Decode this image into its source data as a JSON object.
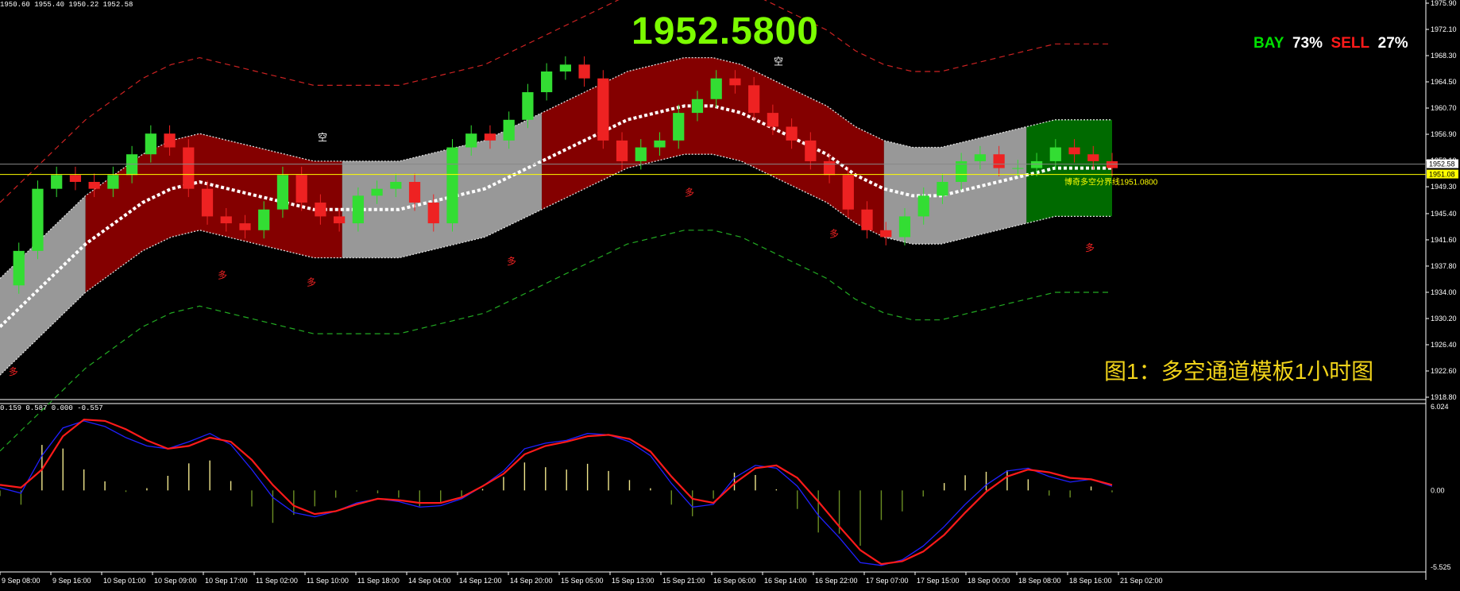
{
  "header": {
    "ohlc_text": "1950.60 1955.40 1950.22 1952.58",
    "current_price_big": "1952.5800",
    "sentiment": {
      "buy_label": "BAY",
      "buy_pct": "73%",
      "sell_label": "SELL",
      "sell_pct": "27%"
    },
    "caption": "图1：多空通道模板1小时图"
  },
  "colors": {
    "background": "#000000",
    "bull_candle": "#33dd33",
    "bear_candle": "#ee2222",
    "bull_channel": "#8b0000",
    "bear_channel": "#007000",
    "neutral_channel": "#a0a0a0",
    "upper_band": "#cc2222",
    "lower_band": "#22aa22",
    "price_line": "#ffff00",
    "macd_signal": "#ff1a1a",
    "macd_line": "#2020ff"
  },
  "chart_data": [
    {
      "type": "line",
      "title": "",
      "xlabel": "",
      "ylabel": "",
      "ylim": [
        1918.8,
        1975.9
      ],
      "y_ticks": [
        "1975.90",
        "1972.10",
        "1968.30",
        "1964.50",
        "1960.70",
        "1956.90",
        "1953.10",
        "1949.30",
        "1945.40",
        "1941.60",
        "1937.80",
        "1934.00",
        "1930.20",
        "1926.40",
        "1922.60",
        "1918.80"
      ],
      "x_ticks": [
        "9 Sep 08:00",
        "9 Sep 16:00",
        "10 Sep 01:00",
        "10 Sep 09:00",
        "10 Sep 17:00",
        "11 Sep 02:00",
        "11 Sep 10:00",
        "11 Sep 18:00",
        "14 Sep 04:00",
        "14 Sep 12:00",
        "14 Sep 20:00",
        "15 Sep 05:00",
        "15 Sep 13:00",
        "15 Sep 21:00",
        "16 Sep 06:00",
        "16 Sep 14:00",
        "16 Sep 22:00",
        "17 Sep 07:00",
        "17 Sep 15:00",
        "18 Sep 00:00",
        "18 Sep 08:00",
        "18 Sep 16:00",
        "21 Sep 02:00"
      ],
      "current_price_label": "1952.58",
      "boundary_price_label": "1951.08",
      "boundary_line_label": "博奇多空分界线1951.0800",
      "series": [
        {
          "values": [
            1935,
            1940,
            1949,
            1951,
            1950,
            1949,
            1951,
            1954,
            1957,
            1955,
            1949,
            1945,
            1944,
            1943,
            1946,
            1951,
            1947,
            1945,
            1944,
            1948,
            1949,
            1950,
            1947,
            1944,
            1955,
            1957,
            1956,
            1959,
            1963,
            1966,
            1967,
            1965,
            1956,
            1953,
            1955,
            1956,
            1960,
            1962,
            1965,
            1964,
            1960,
            1958,
            1956,
            1953,
            1951,
            1946,
            1943,
            1942,
            1945,
            1948,
            1950,
            1953,
            1954,
            1952,
            1952,
            1953,
            1955,
            1954,
            1953,
            1952
          ]
        },
        {
          "values": [
            1929,
            1933,
            1937,
            1941,
            1944,
            1947,
            1949,
            1950,
            1949,
            1948,
            1947,
            1946,
            1946,
            1946,
            1946,
            1947,
            1948,
            1949,
            1951,
            1953,
            1955,
            1957,
            1959,
            1960,
            1961,
            1961,
            1960,
            1958,
            1956,
            1954,
            1951,
            1949,
            1948,
            1948,
            1949,
            1950,
            1951,
            1952,
            1952,
            1952
          ]
        }
      ],
      "markers": {
        "buy_glyph": "多",
        "sell_glyph": "空"
      }
    },
    {
      "type": "line",
      "title": "",
      "header_values": "0.159 0.587 0.000 -0.557",
      "ylim": [
        -5.525,
        6.024
      ],
      "y_ticks": [
        "6.024",
        "0.00",
        "-5.525"
      ],
      "series": [
        {
          "values": [
            0.2,
            -0.2,
            2.5,
            4.5,
            5.0,
            4.6,
            3.8,
            3.2,
            3.0,
            3.5,
            4.1,
            3.3,
            1.5,
            -0.5,
            -1.6,
            -1.9,
            -1.5,
            -0.9,
            -0.6,
            -0.8,
            -1.2,
            -1.1,
            -0.6,
            0.3,
            1.4,
            3.0,
            3.4,
            3.6,
            4.1,
            4.0,
            3.5,
            2.5,
            0.5,
            -1.2,
            -1.0,
            0.9,
            1.8,
            1.6,
            0.3,
            -1.8,
            -3.4,
            -5.2,
            -5.4,
            -5.0,
            -4.0,
            -2.6,
            -1.0,
            0.4,
            1.4,
            1.6,
            1.0,
            0.6,
            0.8,
            0.3
          ]
        },
        {
          "values": [
            0.4,
            0.2,
            1.5,
            3.9,
            5.1,
            5.0,
            4.4,
            3.6,
            3.0,
            3.2,
            3.8,
            3.5,
            2.2,
            0.4,
            -1.1,
            -1.7,
            -1.5,
            -1.0,
            -0.6,
            -0.7,
            -0.9,
            -0.9,
            -0.5,
            0.3,
            1.2,
            2.6,
            3.2,
            3.5,
            3.9,
            4.0,
            3.7,
            2.8,
            1.0,
            -0.6,
            -0.9,
            0.5,
            1.6,
            1.8,
            0.9,
            -0.8,
            -2.6,
            -4.3,
            -5.3,
            -5.1,
            -4.4,
            -3.2,
            -1.6,
            -0.1,
            1.0,
            1.5,
            1.3,
            0.9,
            0.8,
            0.4
          ]
        }
      ]
    }
  ]
}
